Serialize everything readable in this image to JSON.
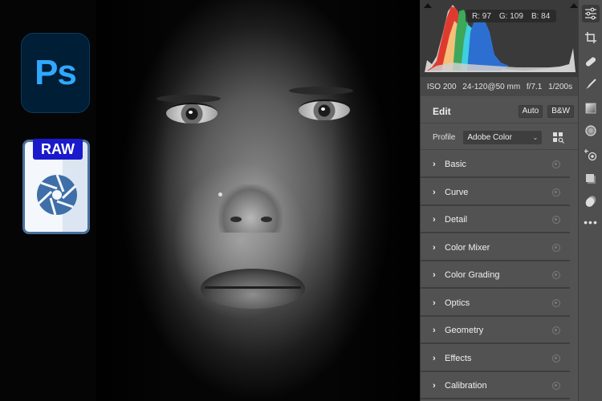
{
  "left_icons": {
    "photoshop_label": "Ps",
    "raw_label": "RAW"
  },
  "histogram": {
    "r_label": "R: 97",
    "g_label": "G: 109",
    "b_label": "B: 84"
  },
  "camera_meta": {
    "iso": "ISO 200",
    "lens": "24-120@50 mm",
    "aperture": "f/7.1",
    "shutter": "1/200s"
  },
  "edit": {
    "title": "Edit",
    "auto_label": "Auto",
    "bw_label": "B&W"
  },
  "profile": {
    "label": "Profile",
    "value": "Adobe Color"
  },
  "sections": [
    {
      "label": "Basic"
    },
    {
      "label": "Curve"
    },
    {
      "label": "Detail"
    },
    {
      "label": "Color Mixer"
    },
    {
      "label": "Color Grading"
    },
    {
      "label": "Optics"
    },
    {
      "label": "Geometry"
    },
    {
      "label": "Effects"
    },
    {
      "label": "Calibration"
    }
  ],
  "toolbar": {
    "tools": [
      "edit-sliders",
      "crop",
      "healing",
      "masking-brush",
      "linear-gradient",
      "radial-filter",
      "red-eye",
      "snapshots",
      "presets",
      "more"
    ]
  },
  "colors": {
    "ps_bg": "#001e36",
    "ps_text": "#31a8ff",
    "raw_badge": "#1a1acc",
    "panel_bg": "#535353"
  }
}
